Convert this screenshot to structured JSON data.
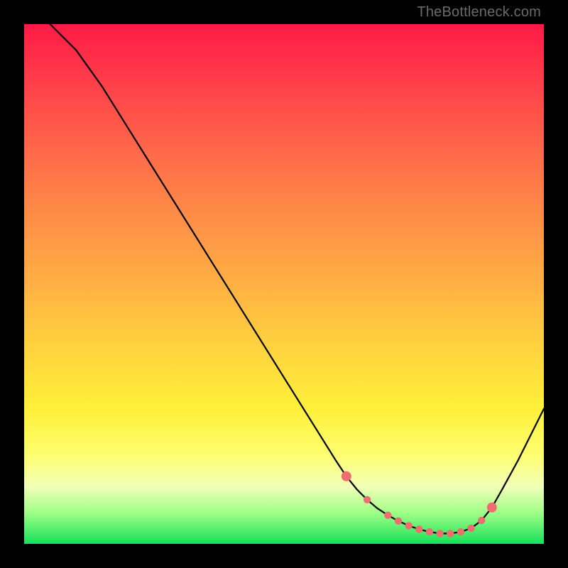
{
  "watermark": "TheBottleneck.com",
  "chart_data": {
    "type": "line",
    "title": "",
    "xlabel": "",
    "ylabel": "",
    "xlim": [
      0,
      100
    ],
    "ylim": [
      0,
      100
    ],
    "series": [
      {
        "name": "curve",
        "x": [
          5,
          10,
          15,
          20,
          25,
          30,
          35,
          40,
          45,
          50,
          55,
          60,
          62,
          64,
          66,
          68,
          70,
          72,
          74,
          76,
          78,
          80,
          82,
          84,
          86,
          88,
          90,
          92,
          95,
          100
        ],
        "values": [
          100,
          95,
          88,
          80,
          72,
          64,
          56,
          48,
          40,
          32,
          24,
          16,
          13,
          10.5,
          8.5,
          6.8,
          5.5,
          4.4,
          3.5,
          2.8,
          2.3,
          2.0,
          2.0,
          2.3,
          3.0,
          4.5,
          7.0,
          10.5,
          16,
          26
        ]
      },
      {
        "name": "highlight-points",
        "x": [
          62,
          66,
          70,
          72,
          74,
          76,
          78,
          80,
          82,
          84,
          86,
          88,
          90
        ],
        "values": [
          13,
          8.5,
          5.5,
          4.4,
          3.5,
          2.8,
          2.3,
          2.0,
          2.0,
          2.3,
          3.0,
          4.5,
          7.0
        ]
      }
    ],
    "colors": {
      "curve_stroke": "#000000",
      "highlight_fill": "#ee6e70"
    }
  }
}
